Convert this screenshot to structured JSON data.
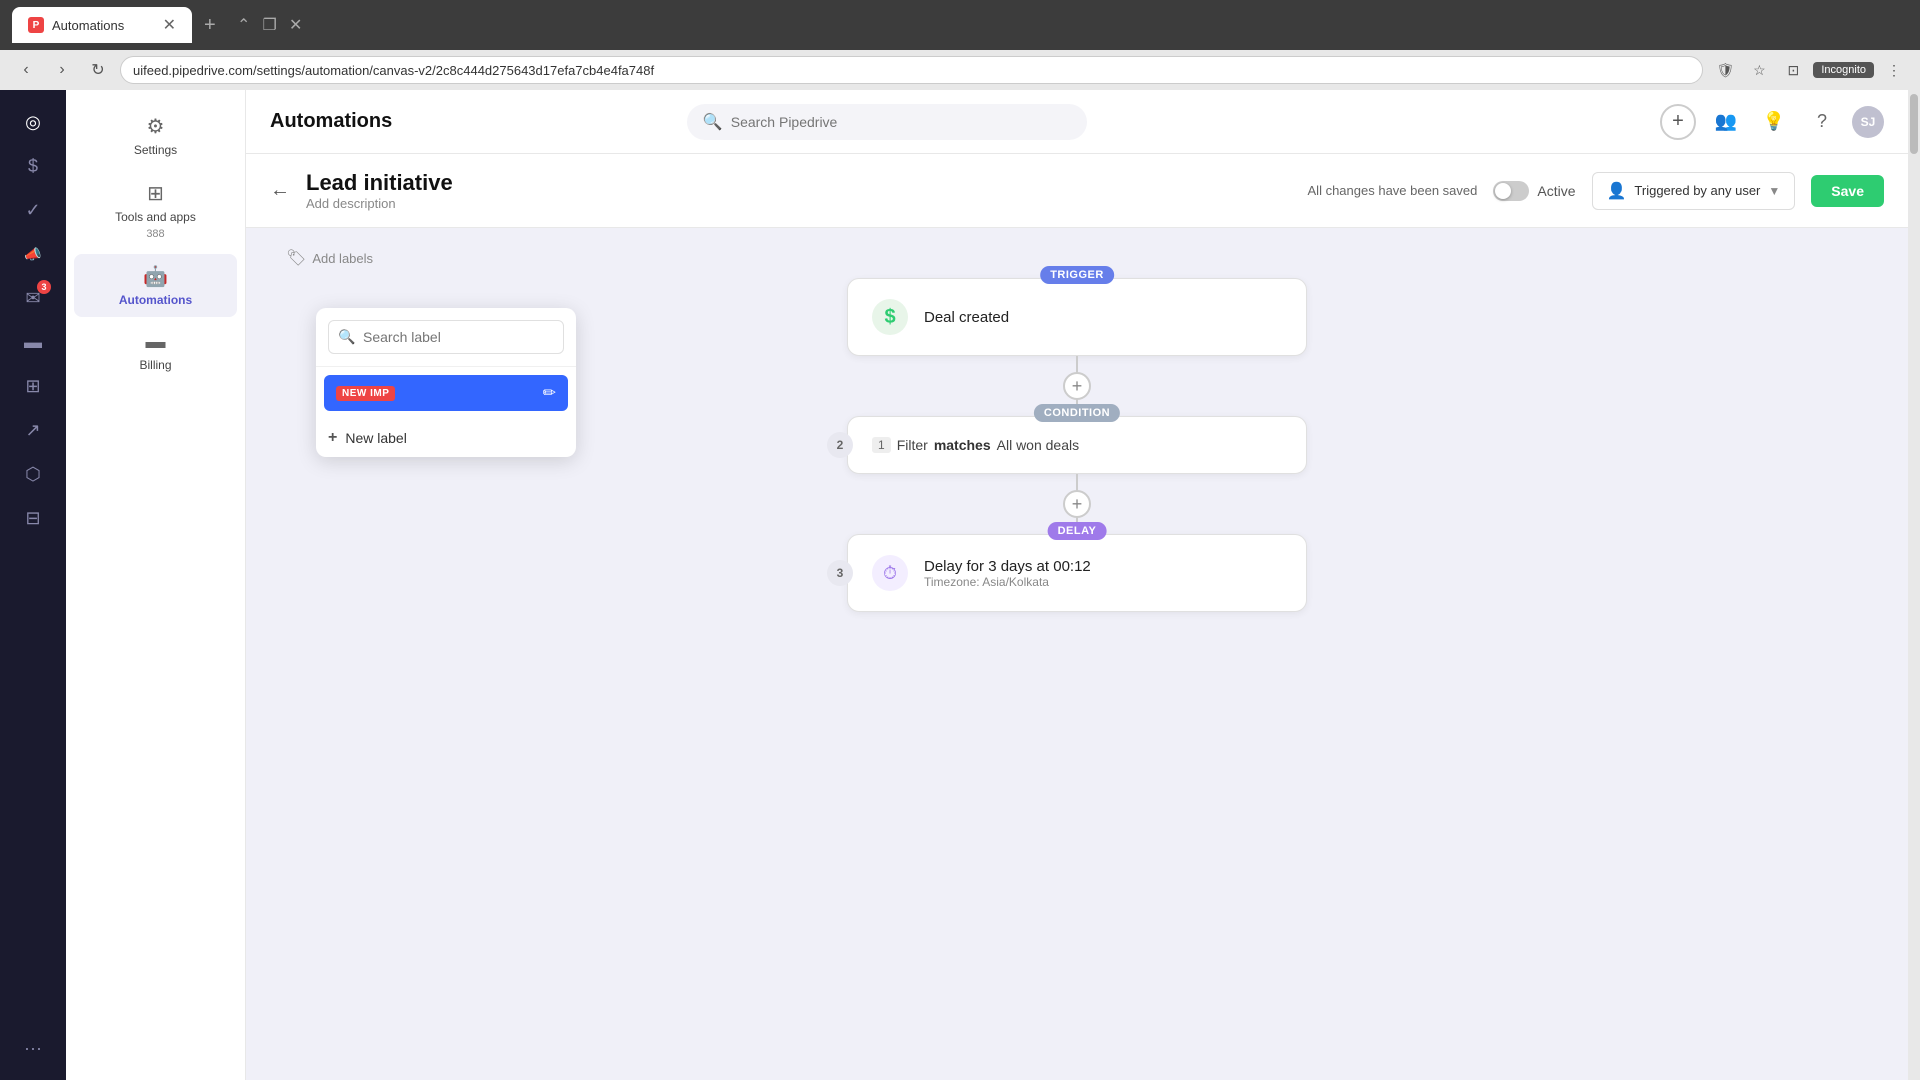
{
  "browser": {
    "tab_title": "Automations",
    "tab_favicon": "P",
    "address": "uifeed.pipedrive.com/settings/automation/canvas-v2/2c8c444d275643d17efa7cb4e4fa748f",
    "incognito_label": "Incognito"
  },
  "top_bar": {
    "page_title": "Automations",
    "search_placeholder": "Search Pipedrive",
    "add_tooltip": "Add",
    "avatar_initials": "SJ"
  },
  "sidebar_left": {
    "icons": [
      {
        "name": "activity-icon",
        "symbol": "◎"
      },
      {
        "name": "dollar-icon",
        "symbol": "$"
      },
      {
        "name": "checkmark-icon",
        "symbol": "✓"
      },
      {
        "name": "megaphone-icon",
        "symbol": "📣"
      },
      {
        "name": "email-icon",
        "symbol": "✉"
      },
      {
        "name": "billing-icon",
        "symbol": "▬"
      },
      {
        "name": "table-icon",
        "symbol": "⊞"
      },
      {
        "name": "graph-icon",
        "symbol": "↗"
      },
      {
        "name": "cube-icon",
        "symbol": "⬡"
      },
      {
        "name": "store-icon",
        "symbol": "⊟"
      },
      {
        "name": "more-icon",
        "symbol": "···"
      }
    ]
  },
  "sidebar_right": {
    "items": [
      {
        "label": "Settings",
        "icon": "⚙",
        "count": ""
      },
      {
        "label": "Tools and apps",
        "icon": "⊞",
        "count": "388"
      },
      {
        "label": "Automations",
        "icon": "🤖",
        "count": "",
        "active": true
      },
      {
        "label": "Billing",
        "icon": "▬",
        "count": ""
      }
    ]
  },
  "canvas_header": {
    "back_label": "←",
    "title": "Lead initiative",
    "subtitle": "Add description",
    "saved_status": "All changes have been saved",
    "active_label": "Active",
    "triggered_by_label": "Triggered by any user",
    "save_button_label": "Save"
  },
  "label_dropdown": {
    "search_placeholder": "Search label",
    "label_search_title": "Search label",
    "existing_label": {
      "badge": "NEW IMP",
      "edit_icon": "✏"
    },
    "new_label": {
      "prefix_icon": "+",
      "label": "New label"
    }
  },
  "add_labels": {
    "icon": "🏷",
    "label": "Add labels"
  },
  "workflow": {
    "nodes": [
      {
        "id": 1,
        "badge": "TRIGGER",
        "badge_type": "trigger",
        "icon": "$",
        "icon_bg": "#e8f5e9",
        "title": "Deal created",
        "number": null
      },
      {
        "id": 2,
        "badge": "CONDITION",
        "badge_type": "condition",
        "icon": "≡",
        "icon_bg": "#f0f0f0",
        "number": "2",
        "condition_num": "1",
        "condition_verb": "Filter",
        "condition_match": "matches",
        "condition_value": "All won deals"
      },
      {
        "id": 3,
        "badge": "DELAY",
        "badge_type": "delay",
        "icon": "⏱",
        "icon_bg": "#f3eeff",
        "number": "3",
        "title": "Delay for 3 days at 00:12",
        "subtitle": "Timezone: Asia/Kolkata"
      }
    ],
    "plus_buttons": [
      "+",
      "+"
    ]
  }
}
